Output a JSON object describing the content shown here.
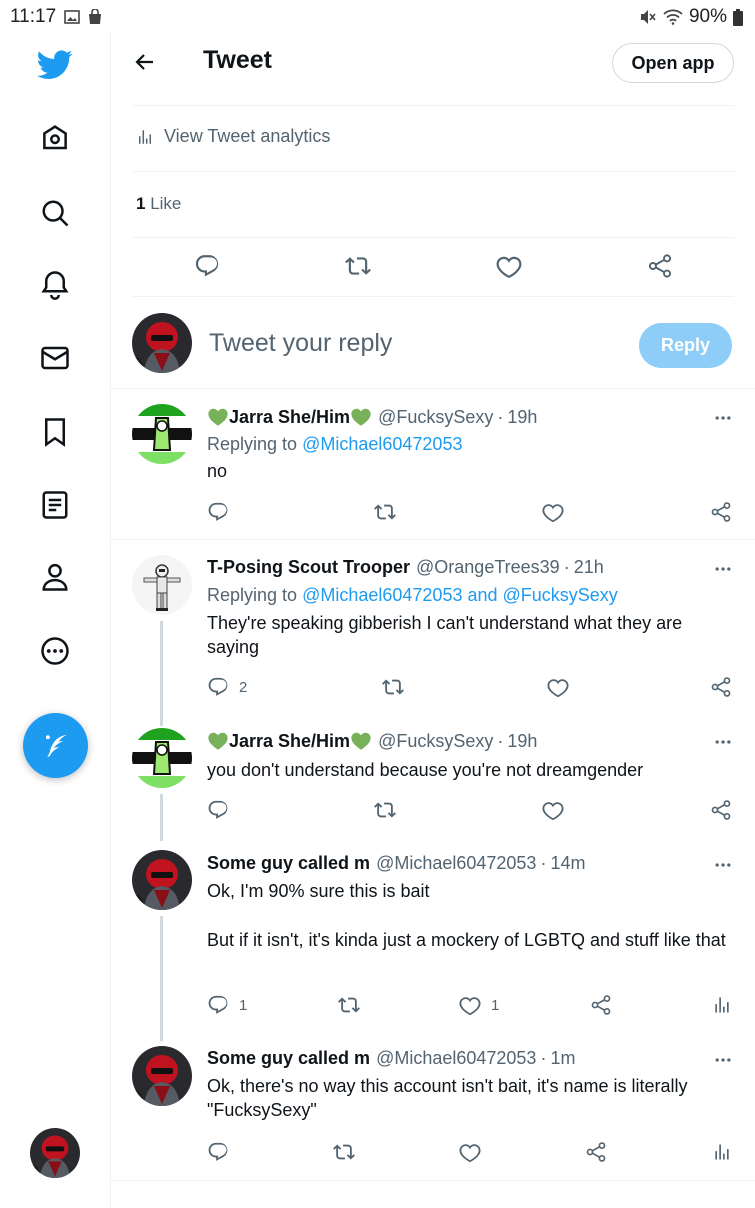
{
  "status_bar": {
    "time": "11:17",
    "battery": "90%"
  },
  "header": {
    "title": "Tweet",
    "open_app_label": "Open app"
  },
  "analytics": {
    "label": "View Tweet analytics"
  },
  "likes": {
    "count": "1",
    "label": "Like"
  },
  "composer": {
    "placeholder": "Tweet your reply",
    "reply_label": "Reply"
  },
  "tweets": [
    {
      "name": "Jarra She/Him",
      "handle": "@FucksySexy",
      "time": "19h",
      "replying_prefix": "Replying to",
      "replying_to": "@Michael60472053",
      "text": "no",
      "reply_count": "",
      "like_count": ""
    },
    {
      "name": "T-Posing Scout Trooper",
      "handle": "@OrangeTrees39",
      "time": "21h",
      "replying_prefix": "Replying to",
      "replying_to": "@Michael60472053 and @FucksySexy",
      "text": "They're speaking gibberish I can't understand what they are saying",
      "reply_count": "2",
      "like_count": ""
    },
    {
      "name": "Jarra She/Him",
      "handle": "@FucksySexy",
      "time": "19h",
      "text": "you don't understand because you're not dreamgender",
      "reply_count": "",
      "like_count": ""
    },
    {
      "name": "Some guy called m",
      "handle": "@Michael60472053",
      "time": "14m",
      "text_line1": "Ok, I'm 90% sure this is bait",
      "text_line2": "But if it isn't, it's kinda just a mockery of LGBTQ and stuff like that",
      "reply_count": "1",
      "like_count": "1"
    },
    {
      "name": "Some guy called m",
      "handle": "@Michael60472053",
      "time": "1m",
      "text": "Ok, there's no way this account isn't bait, it's name is literally \"FucksySexy\"",
      "reply_count": "",
      "like_count": ""
    }
  ],
  "colors": {
    "accent": "#1d9bf0",
    "text_secondary": "#536471",
    "reply_disabled": "#8ecdf8"
  }
}
